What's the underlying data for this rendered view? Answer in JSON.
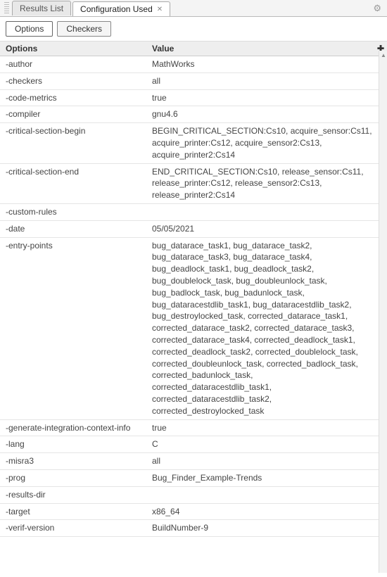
{
  "tabs": [
    {
      "label": "Results List",
      "active": false
    },
    {
      "label": "Configuration Used",
      "active": true
    }
  ],
  "subtabs": [
    {
      "label": "Options",
      "active": true
    },
    {
      "label": "Checkers",
      "active": false
    }
  ],
  "headers": {
    "options": "Options",
    "value": "Value"
  },
  "rows": [
    {
      "opt": "-author",
      "val": "MathWorks"
    },
    {
      "opt": "-checkers",
      "val": "all"
    },
    {
      "opt": "-code-metrics",
      "val": "true"
    },
    {
      "opt": "-compiler",
      "val": "gnu4.6"
    },
    {
      "opt": "-critical-section-begin",
      "val": "BEGIN_CRITICAL_SECTION:Cs10, acquire_sensor:Cs11, acquire_printer:Cs12, acquire_sensor2:Cs13, acquire_printer2:Cs14"
    },
    {
      "opt": "-critical-section-end",
      "val": "END_CRITICAL_SECTION:Cs10, release_sensor:Cs11, release_printer:Cs12, release_sensor2:Cs13, release_printer2:Cs14"
    },
    {
      "opt": "-custom-rules",
      "val": ""
    },
    {
      "opt": "-date",
      "val": "05/05/2021"
    },
    {
      "opt": "-entry-points",
      "val": "bug_datarace_task1, bug_datarace_task2, bug_datarace_task3, bug_datarace_task4, bug_deadlock_task1, bug_deadlock_task2, bug_doublelock_task, bug_doubleunlock_task, bug_badlock_task, bug_badunlock_task, bug_dataracestdlib_task1, bug_dataracestdlib_task2, bug_destroylocked_task, corrected_datarace_task1, corrected_datarace_task2, corrected_datarace_task3, corrected_datarace_task4, corrected_deadlock_task1, corrected_deadlock_task2, corrected_doublelock_task, corrected_doubleunlock_task, corrected_badlock_task, corrected_badunlock_task, corrected_dataracestdlib_task1, corrected_dataracestdlib_task2, corrected_destroylocked_task"
    },
    {
      "opt": "-generate-integration-context-info",
      "val": "true"
    },
    {
      "opt": "-lang",
      "val": "C"
    },
    {
      "opt": "-misra3",
      "val": "all"
    },
    {
      "opt": "-prog",
      "val": "Bug_Finder_Example-Trends"
    },
    {
      "opt": "-results-dir",
      "val": ""
    },
    {
      "opt": "-target",
      "val": "x86_64"
    },
    {
      "opt": "-verif-version",
      "val": "BuildNumber-9"
    }
  ]
}
